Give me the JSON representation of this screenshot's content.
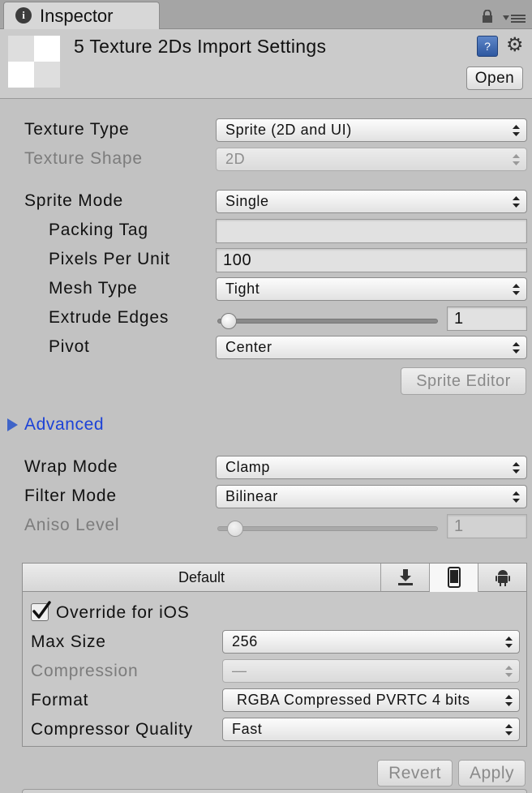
{
  "tab": {
    "title": "Inspector",
    "icon": "info-icon"
  },
  "header": {
    "title": "5 Texture 2Ds Import Settings",
    "open_label": "Open",
    "help_icon_glyph": "?",
    "gear_icon_glyph": "⚙"
  },
  "fields": {
    "texture_type": {
      "label": "Texture Type",
      "value": "Sprite (2D and UI)"
    },
    "texture_shape": {
      "label": "Texture Shape",
      "value": "2D"
    },
    "sprite_mode": {
      "label": "Sprite Mode",
      "value": "Single"
    },
    "packing_tag": {
      "label": "Packing Tag",
      "value": ""
    },
    "pixels_per_unit": {
      "label": "Pixels Per Unit",
      "value": "100"
    },
    "mesh_type": {
      "label": "Mesh Type",
      "value": "Tight"
    },
    "extrude_edges": {
      "label": "Extrude Edges",
      "value": "1"
    },
    "pivot": {
      "label": "Pivot",
      "value": "Center"
    },
    "sprite_editor_label": "Sprite Editor",
    "advanced_label": "Advanced",
    "wrap_mode": {
      "label": "Wrap Mode",
      "value": "Clamp"
    },
    "filter_mode": {
      "label": "Filter Mode",
      "value": "Bilinear"
    },
    "aniso_level": {
      "label": "Aniso Level",
      "value": "1"
    }
  },
  "platform": {
    "tabs": [
      {
        "label": "Default",
        "icon": ""
      },
      {
        "label": "",
        "icon": "download-icon"
      },
      {
        "label": "",
        "icon": "phone-icon"
      },
      {
        "label": "",
        "icon": "android-icon"
      }
    ],
    "active_tab_index": 2,
    "override_label": "Override for iOS",
    "override_checked": true,
    "max_size": {
      "label": "Max Size",
      "value": "256"
    },
    "compression": {
      "label": "Compression",
      "value": "—"
    },
    "format": {
      "label": "Format",
      "value": "RGBA Compressed PVRTC 4 bits"
    },
    "compressor_quality": {
      "label": "Compressor Quality",
      "value": "Fast"
    }
  },
  "footer": {
    "revert_label": "Revert",
    "apply_label": "Apply"
  },
  "colors": {
    "link_blue": "#1c42d7",
    "panel_bg": "#c2c2c2",
    "checkmark": "#111111"
  }
}
